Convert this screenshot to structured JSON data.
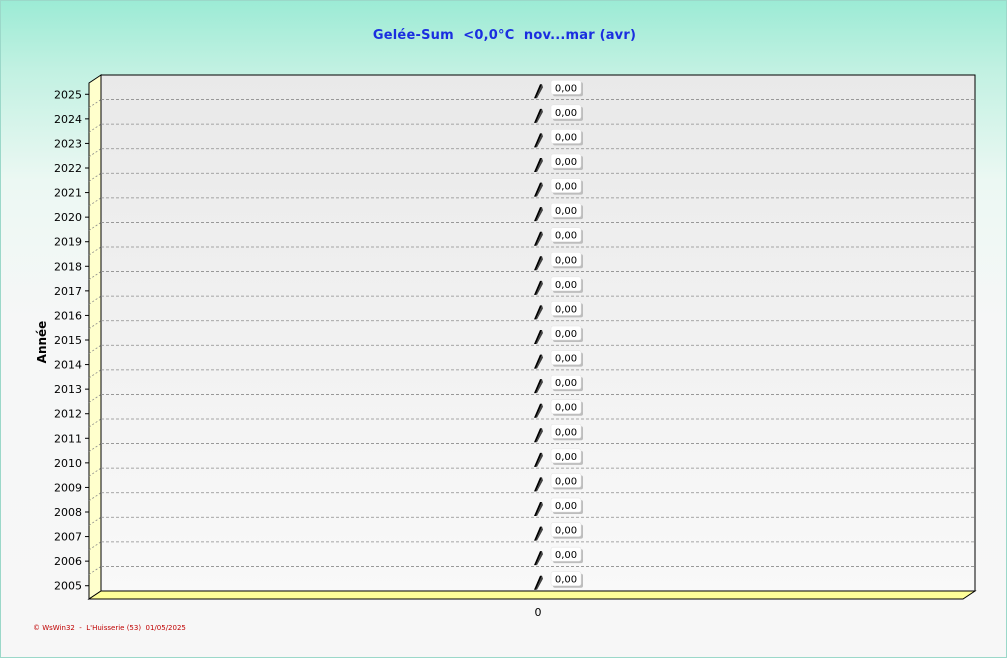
{
  "chart_data": {
    "type": "bar",
    "orientation": "horizontal",
    "title": "Gelée-Sum  <0,0°C  nov...mar (avr)",
    "ylabel": "Année",
    "xlabel": "",
    "categories": [
      "2025",
      "2024",
      "2023",
      "2022",
      "2021",
      "2020",
      "2019",
      "2018",
      "2017",
      "2016",
      "2015",
      "2014",
      "2013",
      "2012",
      "2011",
      "2010",
      "2009",
      "2008",
      "2007",
      "2006",
      "2005"
    ],
    "values": [
      0,
      0,
      0,
      0,
      0,
      0,
      0,
      0,
      0,
      0,
      0,
      0,
      0,
      0,
      0,
      0,
      0,
      0,
      0,
      0,
      0
    ],
    "value_labels": [
      "0,00",
      "0,00",
      "0,00",
      "0,00",
      "0,00",
      "0,00",
      "0,00",
      "0,00",
      "0,00",
      "0,00",
      "0,00",
      "0,00",
      "0,00",
      "0,00",
      "0,00",
      "0,00",
      "0,00",
      "0,00",
      "0,00",
      "0,00",
      "0,00"
    ],
    "x_ticks": [
      "0"
    ],
    "xlim": [
      -1,
      1
    ],
    "grid": true,
    "legend": "none",
    "colors": {
      "bar": "#000000",
      "floor": "#ffff99",
      "title": "#1a2ee0",
      "footer": "#c00000",
      "grid": "#8c8c8c"
    }
  },
  "footer": "© WsWin32  -  L'Huisserie (53)  01/05/2025"
}
